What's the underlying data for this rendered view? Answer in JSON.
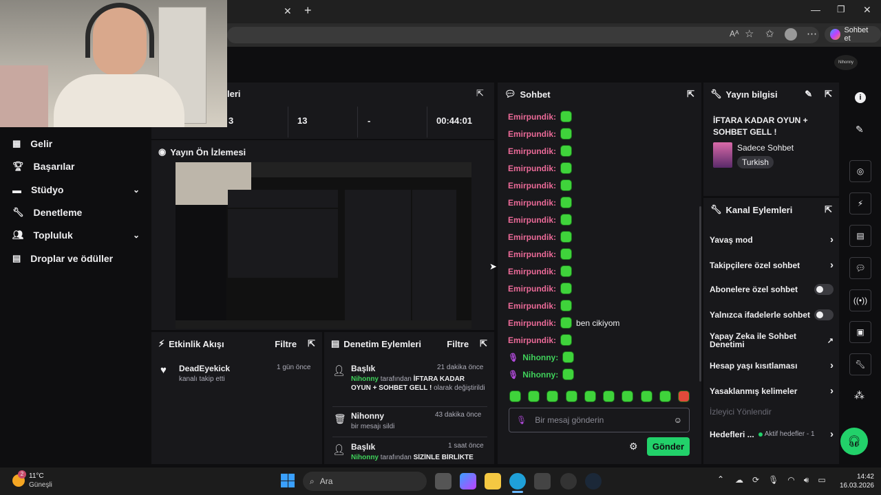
{
  "browser": {
    "copilot_label": "Sohbet et",
    "brand_text": "Nihonny"
  },
  "sidebar": {
    "items": [
      {
        "label": "Gelir"
      },
      {
        "label": "Başarılar"
      },
      {
        "label": "Stüdyo"
      },
      {
        "label": "Denetleme"
      },
      {
        "label": "Topluluk"
      },
      {
        "label": "Droplar ve ödüller"
      }
    ]
  },
  "stats": {
    "title": "leri",
    "values": [
      "3",
      "13",
      "-",
      "00:44:01"
    ]
  },
  "preview": {
    "title": "Yayın Ön İzlemesi"
  },
  "activity": {
    "title": "Etkinlik Akışı",
    "filter": "Filtre",
    "items": [
      {
        "user": "DeadEyekick",
        "action": "kanalı takip etti",
        "time": "1 gün önce"
      }
    ]
  },
  "moderation": {
    "title": "Denetim Eylemleri",
    "filter": "Filtre",
    "items": [
      {
        "type": "Başlık",
        "time": "21 dakika önce",
        "who": "Nihonny",
        "text1": " tarafından ",
        "title": "İFTARA KADAR OYUN + SOHBET GELL !",
        "text2": " olarak değiştirildi"
      },
      {
        "type": "Nihonny",
        "time": "43 dakika önce",
        "text": "bir mesajı sildi"
      },
      {
        "type": "Başlık",
        "time": "1 saat önce",
        "who": "Nihonny",
        "text1": " tarafından ",
        "title": "SİZİNLE BİRLİKTE"
      }
    ]
  },
  "chat": {
    "title": "Sohbet",
    "messages": [
      {
        "user": "Emirpundik:",
        "text": ""
      },
      {
        "user": "Emirpundik:",
        "text": ""
      },
      {
        "user": "Emirpundik:",
        "text": ""
      },
      {
        "user": "Emirpundik:",
        "text": ""
      },
      {
        "user": "Emirpundik:",
        "text": ""
      },
      {
        "user": "Emirpundik:",
        "text": ""
      },
      {
        "user": "Emirpundik:",
        "text": ""
      },
      {
        "user": "Emirpundik:",
        "text": ""
      },
      {
        "user": "Emirpundik:",
        "text": ""
      },
      {
        "user": "Emirpundik:",
        "text": ""
      },
      {
        "user": "Emirpundik:",
        "text": ""
      },
      {
        "user": "Emirpundik:",
        "text": ""
      },
      {
        "user": "Emirpundik:",
        "text": "ben cikiyom"
      },
      {
        "user": "Emirpundik:",
        "text": ""
      },
      {
        "user": "Nihonny:",
        "text": ""
      },
      {
        "user": "Nihonny:",
        "text": ""
      }
    ],
    "placeholder": "Bir mesaj gönderin",
    "send": "Gönder"
  },
  "stream_info": {
    "title": "Yayın bilgisi",
    "stream_title": "İFTARA KADAR OYUN + SOHBET GELL !",
    "category": "Sadece Sohbet",
    "tag": "Turkish"
  },
  "channel_actions": {
    "title": "Kanal Eylemleri",
    "items": [
      {
        "label": "Yavaş mod",
        "ctrl": "chevron"
      },
      {
        "label": "Takipçilere özel sohbet",
        "ctrl": "chevron"
      },
      {
        "label": "Abonelere özel sohbet",
        "ctrl": "toggle"
      },
      {
        "label": "Yalnızca ifadelerle sohbet",
        "ctrl": "toggle"
      },
      {
        "label": "Yapay Zeka ile Sohbet Denetimi",
        "ctrl": "external"
      },
      {
        "label": "Hesap yaşı kısıtlaması",
        "ctrl": "chevron"
      },
      {
        "label": "Yasaklanmış kelimeler",
        "ctrl": "chevron"
      }
    ],
    "section": "İzleyici Yönlendir",
    "goals_label": "Hedefleri ...",
    "goals_status": "Aktif hedefler - 1"
  },
  "taskbar": {
    "weather_temp": "11°C",
    "weather_desc": "Güneşli",
    "weather_badge": "2",
    "search": "Ara",
    "time": "14:42",
    "date": "16.03.2026"
  }
}
